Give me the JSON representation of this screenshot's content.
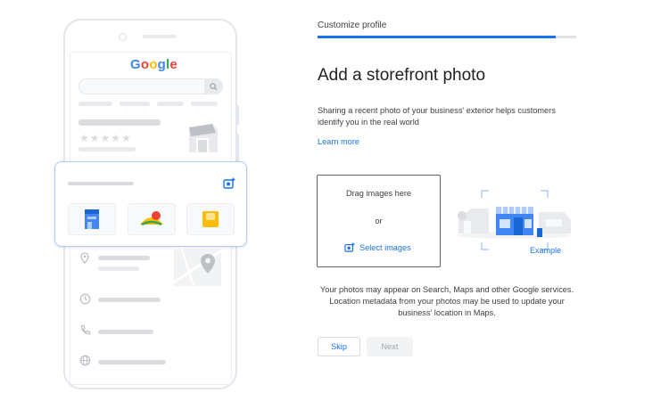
{
  "phone": {
    "logo_letters": [
      {
        "char": "G",
        "color": "#4285F4"
      },
      {
        "char": "o",
        "color": "#EA4335"
      },
      {
        "char": "o",
        "color": "#FBBC05"
      },
      {
        "char": "g",
        "color": "#4285F4"
      },
      {
        "char": "l",
        "color": "#34A853"
      },
      {
        "char": "e",
        "color": "#EA4335"
      }
    ],
    "stars": "★★★★★"
  },
  "step": {
    "label": "Customize profile",
    "progress": 0.92
  },
  "main": {
    "title": "Add a storefront photo",
    "description": "Sharing a recent photo of your business' exterior helps customers identify you in the real world",
    "learn_more": "Learn more"
  },
  "upload": {
    "drag_text": "Drag images here",
    "or_text": "or",
    "select_label": "Select images",
    "example_label": "Example"
  },
  "disclaimer": "Your photos may appear on Search, Maps and other Google services. Location metadata from your photos may be used to update your business' location in Maps.",
  "actions": {
    "skip_label": "Skip",
    "next_label": "Next"
  },
  "colors": {
    "accent": "#1a73e8",
    "card_border": "#aecbfa",
    "muted": "#dadce0"
  }
}
